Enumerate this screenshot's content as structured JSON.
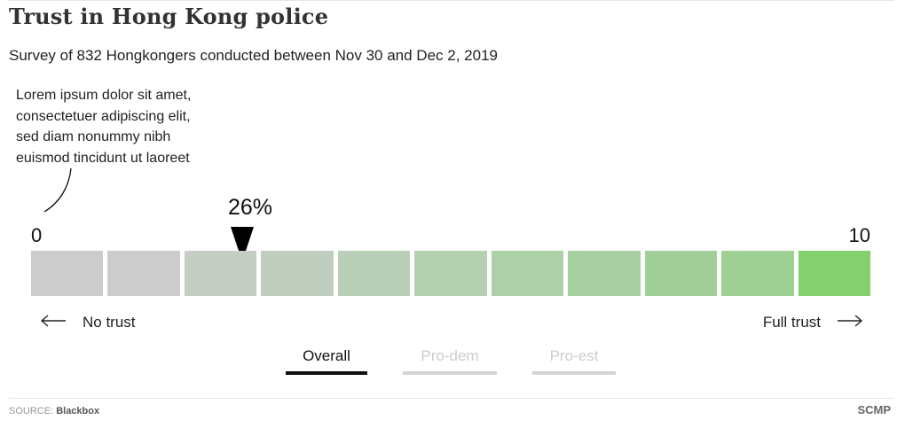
{
  "header": {
    "title": "Trust in Hong Kong police",
    "subtitle": "Survey of 832 Hongkongers conducted between Nov 30 and Dec 2, 2019"
  },
  "annotation": {
    "lines": [
      "Lorem ipsum dolor sit amet,",
      "consectetuer adipiscing elit,",
      "sed diam nonummy nibh",
      "euismod tincidunt ut laoreet"
    ]
  },
  "chart_data": {
    "type": "bar",
    "categories": [
      "0",
      "1",
      "2",
      "3",
      "4",
      "5",
      "6",
      "7",
      "8",
      "9",
      "10"
    ],
    "scale": {
      "min_label": "0",
      "max_label": "10"
    },
    "colors": [
      "#cccccc",
      "#cccccc",
      "#c5cdc5",
      "#c0cec0",
      "#b9cfb7",
      "#b4d0b0",
      "#aed0a8",
      "#a8cfa1",
      "#a2cf99",
      "#9ecf93",
      "#84cf6e"
    ],
    "marker": {
      "category": "2",
      "label": "26%"
    },
    "end_labels": {
      "left": "No trust",
      "right": "Full trust"
    }
  },
  "tabs": [
    {
      "label": "Overall",
      "active": true
    },
    {
      "label": "Pro-dem",
      "active": false
    },
    {
      "label": "Pro-est",
      "active": false
    }
  ],
  "icons": {
    "left_arrow": "arrow-left-icon",
    "right_arrow": "arrow-right-icon",
    "marker": "triangle-down-icon"
  },
  "footer": {
    "source_label": "SOURCE:",
    "source_name": "Blackbox",
    "brand": "SCMP"
  }
}
